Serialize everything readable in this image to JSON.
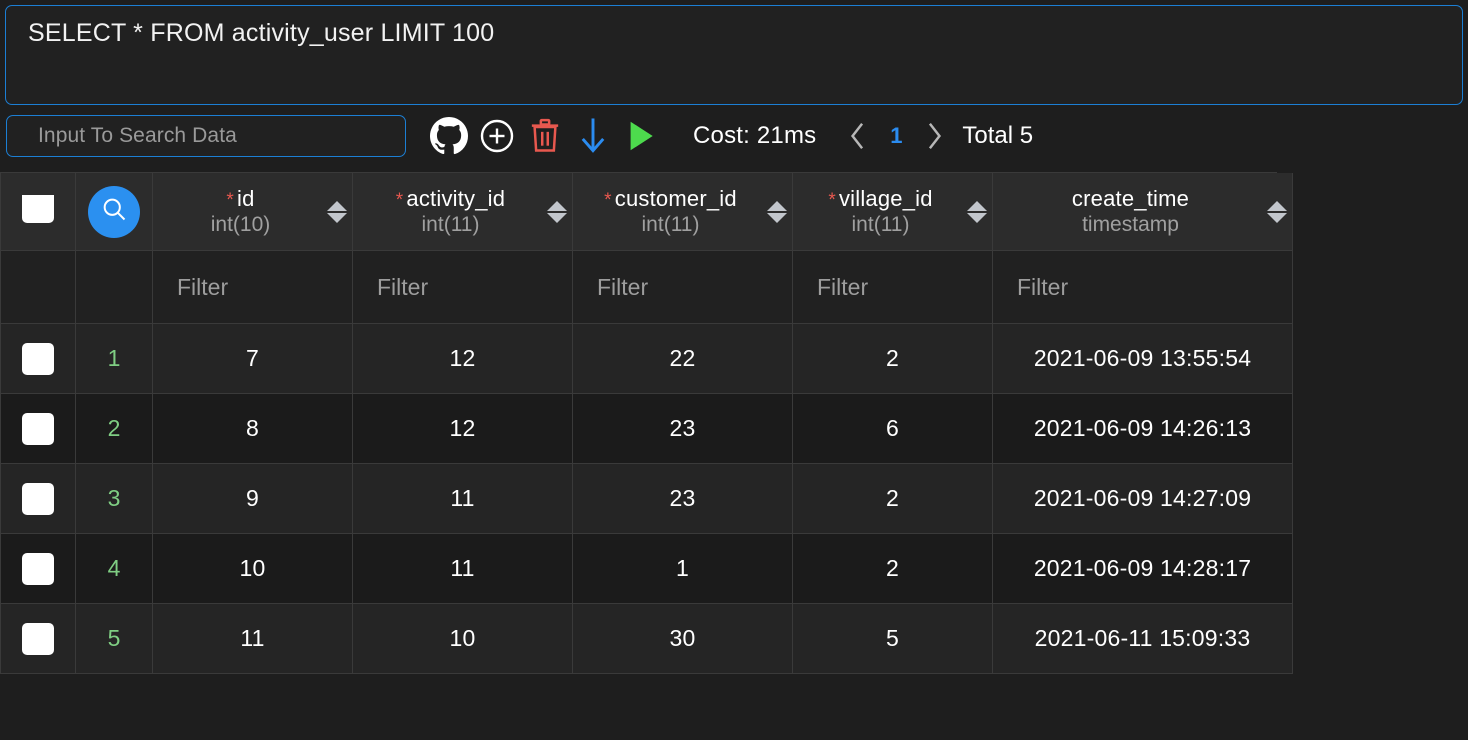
{
  "editor": {
    "sql": "SELECT * FROM activity_user LIMIT 100"
  },
  "toolbar": {
    "search_placeholder": "Input To Search Data",
    "search_value": "",
    "github_label": "github-icon",
    "add_label": "add-icon",
    "delete_label": "delete-icon",
    "download_label": "download-icon",
    "run_label": "run-icon",
    "cost": "Cost: 21ms",
    "prev_label": "‹",
    "page": "1",
    "next_label": "›",
    "total": "Total 5"
  },
  "table": {
    "filter_placeholder": "Filter",
    "columns": [
      {
        "name": "id",
        "type": "int(10)",
        "required": true
      },
      {
        "name": "activity_id",
        "type": "int(11)",
        "required": true
      },
      {
        "name": "customer_id",
        "type": "int(11)",
        "required": true
      },
      {
        "name": "village_id",
        "type": "int(11)",
        "required": true
      },
      {
        "name": "create_time",
        "type": "timestamp",
        "required": false
      }
    ],
    "rows": [
      {
        "idx": "1",
        "id": "7",
        "activity_id": "12",
        "customer_id": "22",
        "village_id": "2",
        "create_time": "2021-06-09 13:55:54"
      },
      {
        "idx": "2",
        "id": "8",
        "activity_id": "12",
        "customer_id": "23",
        "village_id": "6",
        "create_time": "2021-06-09 14:26:13"
      },
      {
        "idx": "3",
        "id": "9",
        "activity_id": "11",
        "customer_id": "23",
        "village_id": "2",
        "create_time": "2021-06-09 14:27:09"
      },
      {
        "idx": "4",
        "id": "10",
        "activity_id": "11",
        "customer_id": "1",
        "village_id": "2",
        "create_time": "2021-06-09 14:28:17"
      },
      {
        "idx": "5",
        "id": "11",
        "activity_id": "10",
        "customer_id": "30",
        "village_id": "5",
        "create_time": "2021-06-11 15:09:33"
      }
    ]
  },
  "colors": {
    "accent_blue": "#1c7fd4",
    "page_blue": "#2b8cf0",
    "run_green": "#4ddb4d",
    "delete_red": "#e8584f",
    "index_green": "#7fce83",
    "required_red": "#e8584f"
  }
}
